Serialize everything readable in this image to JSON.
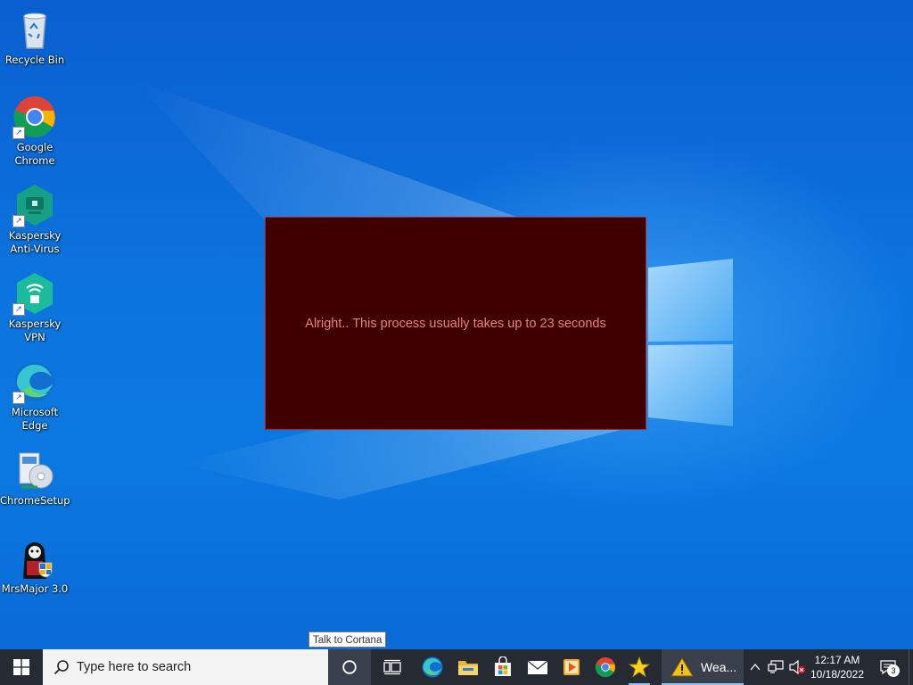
{
  "desktop": {
    "icons": [
      {
        "label": "Recycle Bin",
        "icon": "recycle-bin-icon"
      },
      {
        "label": "Google\nChrome",
        "icon": "chrome-icon"
      },
      {
        "label": "Kaspersky\nAnti-Virus",
        "icon": "kaspersky-antivirus-icon"
      },
      {
        "label": "Kaspersky\nVPN",
        "icon": "kaspersky-vpn-icon"
      },
      {
        "label": "Microsoft\nEdge",
        "icon": "edge-icon"
      },
      {
        "label": "ChromeSetup",
        "icon": "installer-icon"
      },
      {
        "label": "MrsMajor 3.0",
        "icon": "mrsmajor-icon"
      }
    ]
  },
  "popup": {
    "message": "Alright.. This process usually takes up to 23 seconds",
    "background": "#3f0000",
    "text_color": "#e9807c"
  },
  "tooltip": {
    "text": "Talk to Cortana"
  },
  "taskbar": {
    "search_placeholder": "Type here to search",
    "pinned": [
      "cortana-icon",
      "task-view-icon",
      "edge-icon",
      "file-explorer-icon",
      "microsoft-store-icon",
      "mail-icon",
      "media-player-icon",
      "chrome-icon",
      "star-app-icon"
    ],
    "active_window": {
      "label": "Wea...",
      "icon": "warning-icon"
    },
    "tray": {
      "time": "12:17 AM",
      "date": "10/18/2022",
      "notification_count": "3"
    },
    "accent": "#8fc4f0"
  }
}
